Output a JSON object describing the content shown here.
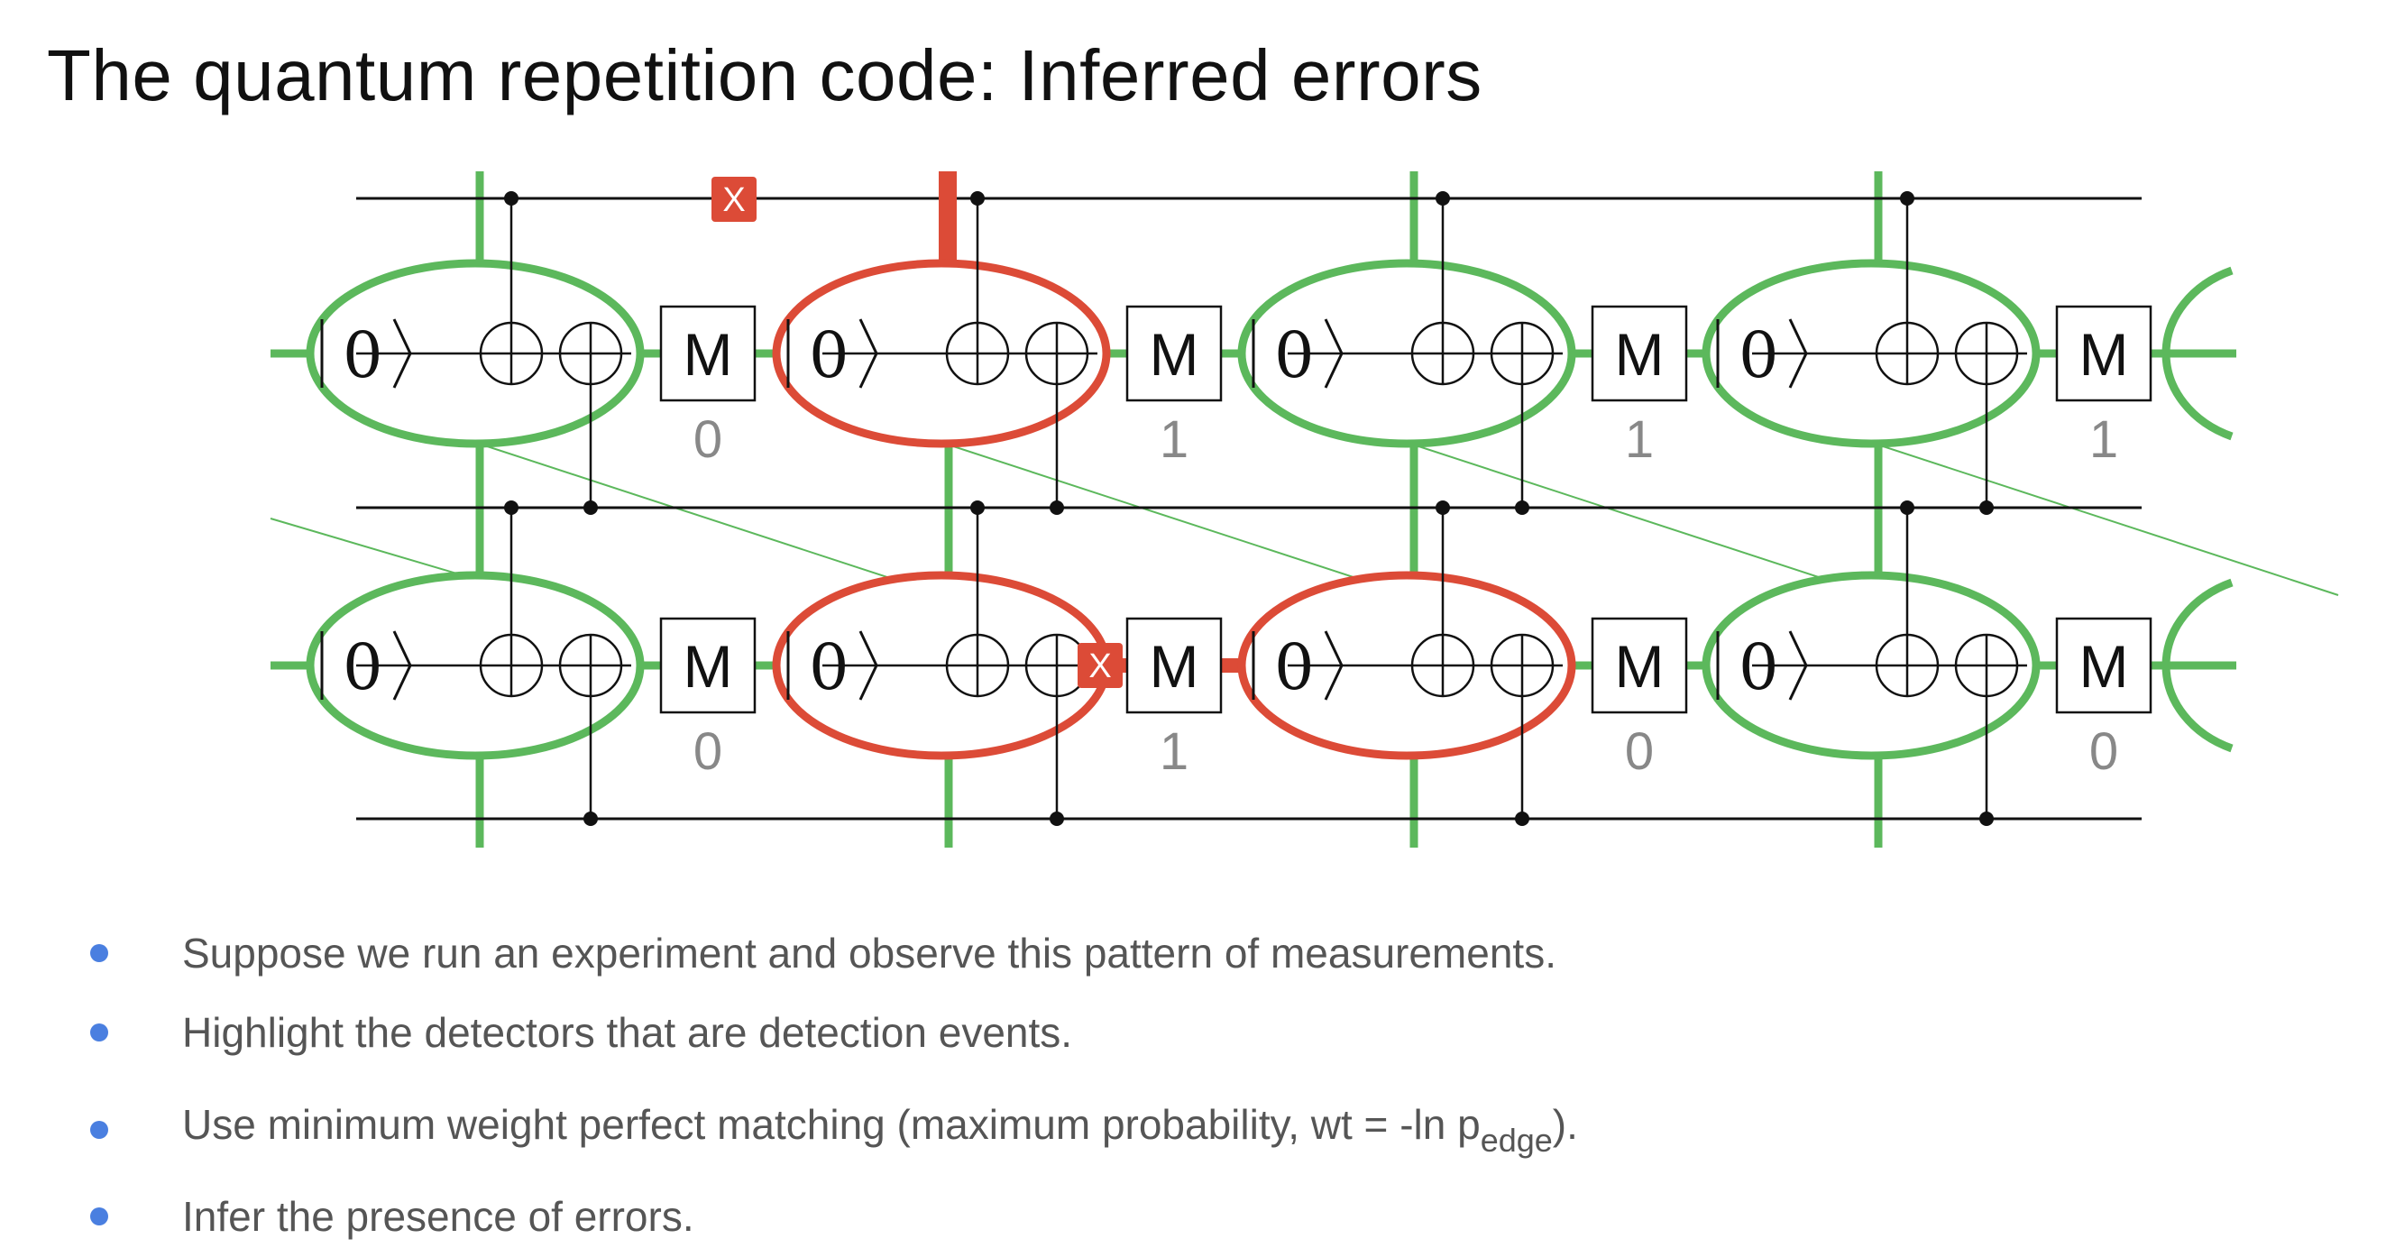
{
  "slide": {
    "title": "The quantum repetition code: Inferred errors"
  },
  "diagram": {
    "colors": {
      "green": "#5cb85c",
      "red": "#dc4b37",
      "wire": "#111111",
      "measurement_text": "#888888"
    },
    "gates": {
      "ket_label": "|0⟩",
      "measure_label": "M",
      "error_label": "X"
    },
    "rounds": [
      {
        "top_result": "0",
        "bottom_result": "0"
      },
      {
        "top_result": "1",
        "bottom_result": "1"
      },
      {
        "top_result": "1",
        "bottom_result": "0"
      },
      {
        "top_result": "1",
        "bottom_result": "0"
      }
    ],
    "detectors": [
      {
        "row": "top",
        "round": 0,
        "state": "normal"
      },
      {
        "row": "top",
        "round": 1,
        "state": "detection_event"
      },
      {
        "row": "top",
        "round": 2,
        "state": "normal"
      },
      {
        "row": "top",
        "round": 3,
        "state": "normal"
      },
      {
        "row": "bottom",
        "round": 0,
        "state": "normal"
      },
      {
        "row": "bottom",
        "round": 1,
        "state": "detection_event"
      },
      {
        "row": "bottom",
        "round": 2,
        "state": "detection_event"
      },
      {
        "row": "bottom",
        "round": 3,
        "state": "normal"
      }
    ],
    "inferred_errors": [
      {
        "location": "top data qubit, between round 0 and round 1",
        "label": "X"
      },
      {
        "location": "bottom ancilla, between round 1 and round 2",
        "label": "X"
      }
    ]
  },
  "bullets": [
    {
      "text": "Suppose we run an experiment and observe this pattern of measurements."
    },
    {
      "text": "Highlight the detectors that are detection events."
    },
    {
      "text": "Use minimum weight perfect matching (maximum probability, wt = -ln p",
      "sub": "edge",
      "after": ")."
    },
    {
      "text": "Infer the presence of errors."
    }
  ]
}
